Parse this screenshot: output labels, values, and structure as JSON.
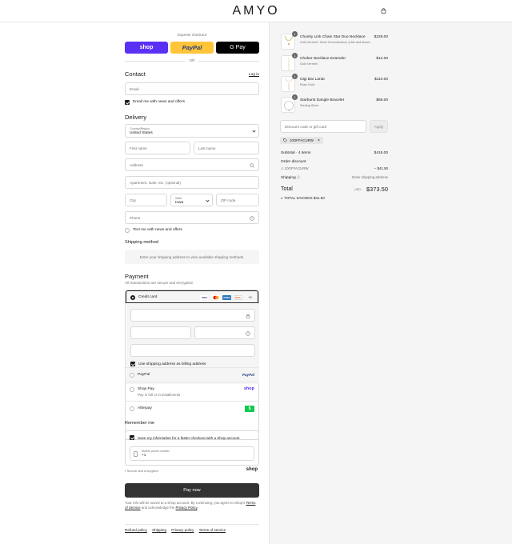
{
  "header": {
    "logo": "AMYO",
    "cart_icon": "shopping-bag-icon"
  },
  "express": {
    "label": "Express checkout",
    "shop": "shop",
    "paypal": "PayPal",
    "gpay": "G Pay",
    "or": "OR"
  },
  "contact": {
    "heading": "Contact",
    "login": "Log in",
    "email_placeholder": "Email",
    "newsletter_label": "Email me with news and offers",
    "newsletter_checked": true
  },
  "delivery": {
    "heading": "Delivery",
    "country_label": "Country/Region",
    "country_value": "United States",
    "first_name": "First name",
    "last_name": "Last name",
    "address": "Address",
    "apartment": "Apartment, suite, etc. (optional)",
    "city": "City",
    "state_label": "State",
    "state_value": "Iowa",
    "zip": "ZIP code",
    "phone": "Phone",
    "sms_label": "Text me with news and offers"
  },
  "shipping": {
    "heading": "Shipping method",
    "message": "Enter your shipping address to view available shipping methods."
  },
  "payment": {
    "heading": "Payment",
    "subtitle": "All transactions are secure and encrypted.",
    "credit_card": "Credit card",
    "card_logos": [
      "VISA",
      "MC",
      "AMEX",
      "DISC"
    ],
    "more_cards": "+3",
    "billing_label": "Use shipping address as billing address",
    "paypal": "PayPal",
    "paypal_badge": "PayPal",
    "shop_pay": "Shop Pay",
    "shop_pay_sub": "Pay in full or in installments",
    "shop_badge": "shop",
    "afterpay": "Afterpay",
    "afterpay_badge": "$"
  },
  "remember": {
    "heading": "Remember me",
    "save_label": "Save my information for a faster checkout with a Shop account",
    "mobile_label": "Mobile phone number",
    "mobile_prefix": "+1",
    "secure": "Secure and encrypted",
    "shop_brand": "shop"
  },
  "pay_now": "Pay now",
  "fine_print": {
    "part1": "Your info will be saved to a Shop account. By continuing, you agree to Shop's ",
    "terms": "Terms of Service",
    "part2": " and acknowledge the ",
    "privacy": "Privacy Policy",
    "part3": "."
  },
  "footer": [
    "Refund policy",
    "Shipping",
    "Privacy policy",
    "Terms of service"
  ],
  "cart": {
    "items": [
      {
        "qty": "1",
        "name": "Chunky Link Chain Star Duo Necklace",
        "variant": "Gold Vermeil / Neck Circumference (15in and Above",
        "price": "$228.00"
      },
      {
        "qty": "1",
        "name": "Choker Necklace Extender",
        "variant": "Gold Vermeil",
        "price": "$12.00"
      },
      {
        "qty": "1",
        "name": "Gigi Bar Lariat",
        "variant": "Rose Gold",
        "price": "$110.00"
      },
      {
        "qty": "1",
        "name": "Starburst Dangle Bracelet",
        "variant": "Sterling Silver",
        "price": "$65.00"
      }
    ],
    "discount_placeholder": "Discount code or gift card",
    "apply": "Apply",
    "applied_code": "10OFFACURW",
    "subtotal_label": "Subtotal · 4 items",
    "subtotal": "$415.00",
    "order_discount_label": "Order discount",
    "order_discount_code": "10OFFACURW",
    "order_discount": "– $41.50",
    "shipping_label": "Shipping",
    "shipping_value": "Enter shipping address",
    "total_label": "Total",
    "currency": "USD",
    "total": "$373.50",
    "savings_label": "TOTAL SAVINGS",
    "savings": "$41.50"
  }
}
